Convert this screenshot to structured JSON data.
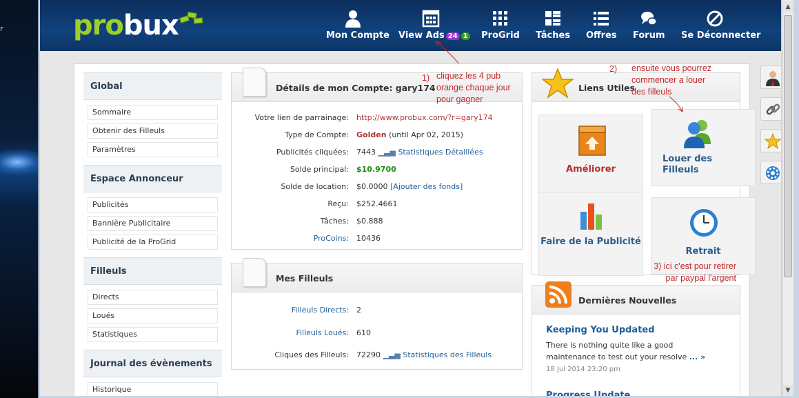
{
  "desktop": {
    "edge_char": "r"
  },
  "header": {
    "logo_part1": "pro",
    "logo_part2": "bux",
    "nav": [
      {
        "label": "Mon Compte",
        "icon": "user-icon"
      },
      {
        "label": "View Ads",
        "icon": "grid-window-icon",
        "badge_purple": "24",
        "badge_green": "1"
      },
      {
        "label": "ProGrid",
        "icon": "dots-grid-icon"
      },
      {
        "label": "Tâches",
        "icon": "list-blocks-icon"
      },
      {
        "label": "Offres",
        "icon": "list-lines-icon"
      },
      {
        "label": "Forum",
        "icon": "chat-bubbles-icon"
      },
      {
        "label": "Se Déconnecter",
        "icon": "no-entry-icon"
      }
    ]
  },
  "sidebar": {
    "sections": [
      {
        "title": "Global",
        "items": [
          "Sommaire",
          "Obtenir des Filleuls",
          "Paramètres"
        ]
      },
      {
        "title": "Espace Annonceur",
        "items": [
          "Publicités",
          "Bannière Publicitaire",
          "Publicité de la ProGrid"
        ]
      },
      {
        "title": "Filleuls",
        "items": [
          "Directs",
          "Loués",
          "Statistiques"
        ]
      },
      {
        "title": "Journal des évènements",
        "items": [
          "Historique"
        ]
      }
    ]
  },
  "account": {
    "title": "Détails de mon Compte: gary174",
    "rows": [
      {
        "label": "Votre lien de parrainage:",
        "value": "http://www.probux.com/?r=gary174"
      },
      {
        "label": "Type de Compte:",
        "value": "Golden",
        "extra": "(until Apr 02, 2015)"
      },
      {
        "label": "Publicités cliquées:",
        "value": "7443",
        "link": "Statistiques Détaillées"
      },
      {
        "label": "Solde principal:",
        "value": "$10.9700"
      },
      {
        "label": "Solde de location:",
        "value": "$0.0000",
        "link": "[Ajouter des fonds]"
      },
      {
        "label": "Reçu:",
        "value": "$252.4661"
      },
      {
        "label": "Tâches:",
        "value": "$0.888"
      },
      {
        "label": "ProCoins:",
        "value": "10436"
      }
    ]
  },
  "referrals": {
    "title": "Mes Filleuls",
    "rows": [
      {
        "label": "Filleuls Directs:",
        "value": "2"
      },
      {
        "label": "Filleuls Loués:",
        "value": "610"
      },
      {
        "label": "Cliques des Filleuls:",
        "value": "72290",
        "link": "Statistiques des Filleuls"
      }
    ]
  },
  "useful_links": {
    "title": "Liens Utiles",
    "tiles": [
      {
        "label": "Améliorer",
        "icon": "upgrade-box-icon"
      },
      {
        "label": "Louer des Filleuls",
        "icon": "users-icon"
      },
      {
        "label": "Faire de la Publicité",
        "icon": "bar-chart-icon"
      },
      {
        "label": "Retrait",
        "icon": "clock-icon"
      }
    ]
  },
  "news": {
    "title": "Dernières Nouvelles",
    "items": [
      {
        "title": "Keeping You Updated",
        "body": "There is nothing quite like a good maintenance to test out your resolve",
        "more": "... »",
        "date": "18 Jul 2014 23:20 pm"
      },
      {
        "title": "Progress Update"
      }
    ]
  },
  "annotations": {
    "a1_num": "1)",
    "a1_text": [
      "cliquez les 4 pub",
      "orange chaque jour",
      "pour gagner"
    ],
    "a2_num": "2)",
    "a2_text": [
      "ensuite vous pourrez",
      "commencer a louer",
      "des filleuls"
    ],
    "a3_text": [
      "3) ici c'est pour retirer",
      "par paypal l'argent"
    ]
  },
  "colors": {
    "header_blue": "#11427c",
    "logo_green": "#9dcf2c",
    "badge_purple": "#a02fd0",
    "badge_green": "#3d9b1e",
    "annotation_red": "#c0292b"
  }
}
